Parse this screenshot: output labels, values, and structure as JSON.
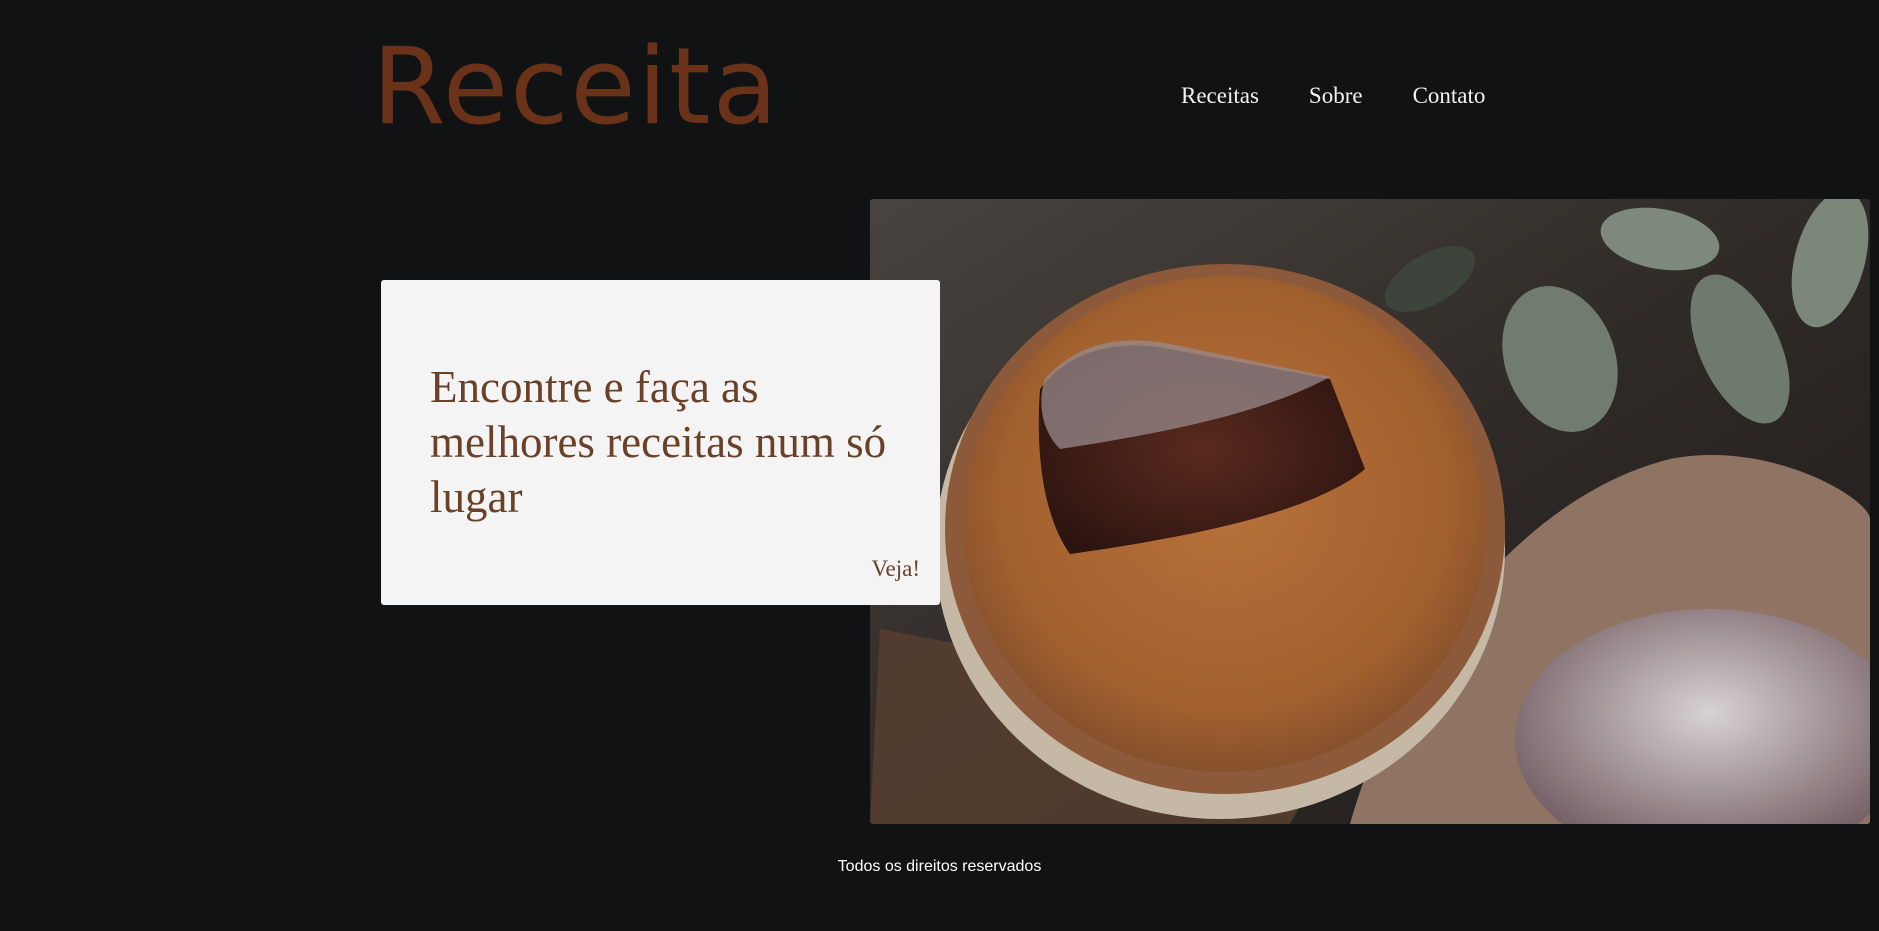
{
  "header": {
    "logo_text": "Receita",
    "nav": [
      {
        "label": "Receitas"
      },
      {
        "label": "Sobre"
      },
      {
        "label": "Contato"
      }
    ]
  },
  "hero": {
    "headline": "Encontre e faça as melhores receitas num só lugar",
    "cta_label": "Veja!",
    "image_subject": "chocolate-cake-slice-photo"
  },
  "footer": {
    "text": "Todos os direitos reservados"
  },
  "colors": {
    "background": "#111213",
    "logo": "#6b321a",
    "card_background": "#f4f4f4",
    "card_text": "#6a4128",
    "nav_text": "#f2f2f2"
  }
}
